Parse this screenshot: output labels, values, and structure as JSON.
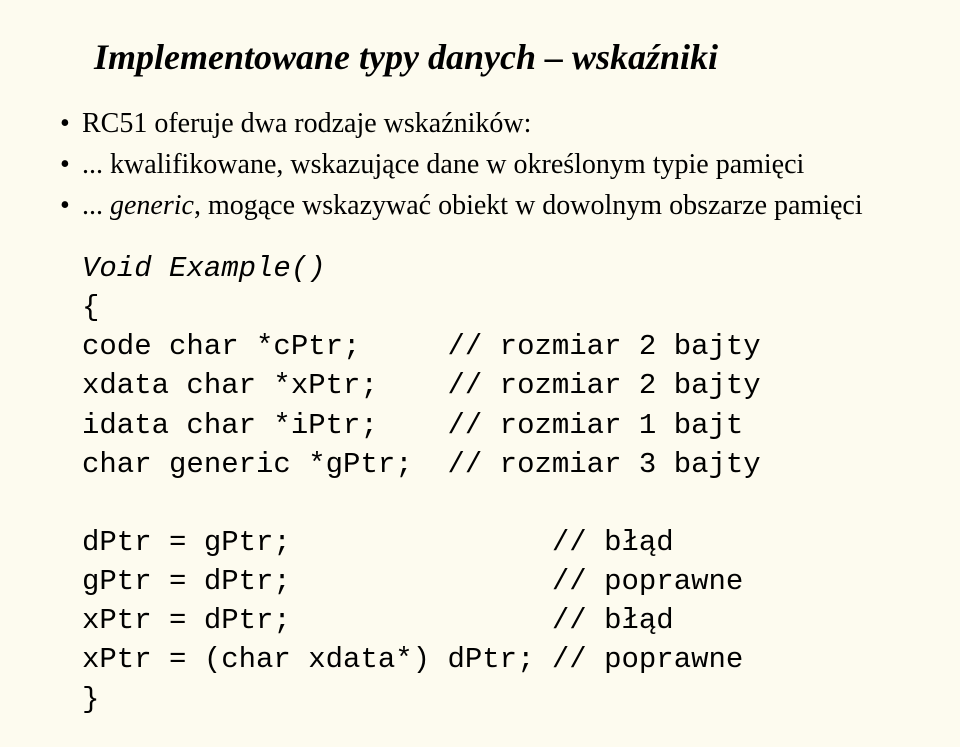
{
  "title": "Implementowane typy danych – wskaźniki",
  "bullets": [
    {
      "prefix": "RC51 oferuje dwa rodzaje wskaźników:",
      "italic": false
    },
    {
      "prefix": "... kwalifikowane, wskazujące dane w określonym typie pamięci",
      "italic": false
    },
    {
      "prefix": "... ",
      "em": "generic",
      "suffix": ", mogące wskazywać obiekt w dowolnym obszarze pamięci",
      "italic": true
    }
  ],
  "code": {
    "l1": "Void Example()",
    "l2": "{",
    "l3": "code char *cPtr;     // rozmiar 2 bajty",
    "l4": "xdata char *xPtr;    // rozmiar 2 bajty",
    "l5": "idata char *iPtr;    // rozmiar 1 bajt",
    "l6": "char generic *gPtr;  // rozmiar 3 bajty",
    "l7": "",
    "l8": "dPtr = gPtr;               // błąd",
    "l9": "gPtr = dPtr;               // poprawne",
    "l10": "xPtr = dPtr;               // błąd",
    "l11": "xPtr = (char xdata*) dPtr; // poprawne",
    "l12": "}"
  }
}
